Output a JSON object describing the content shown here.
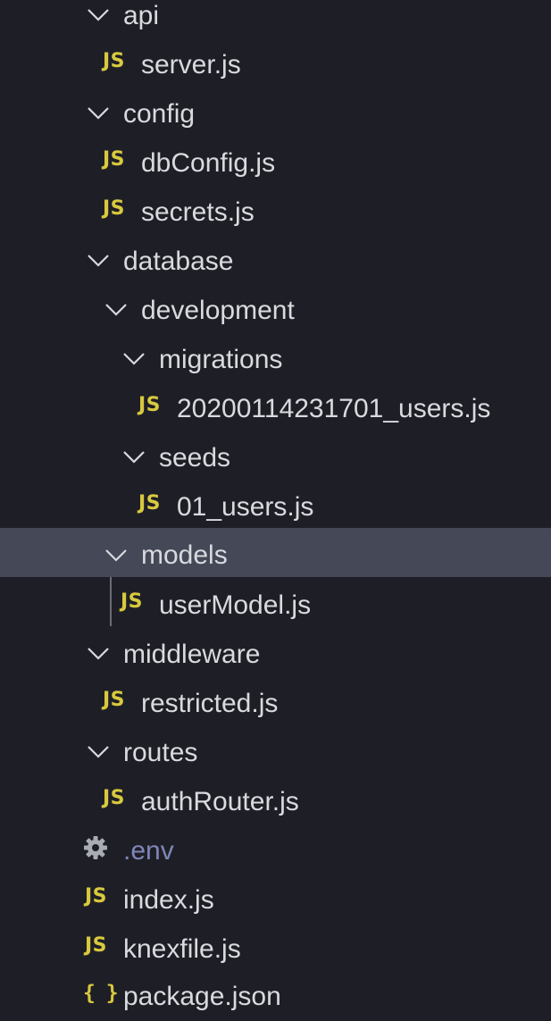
{
  "explorer": {
    "items": [
      {
        "label": "api",
        "type": "folder",
        "icon": "chevron-down-icon"
      },
      {
        "label": "server.js",
        "type": "file",
        "icon": "javascript-file-icon",
        "icon_text": "JS"
      },
      {
        "label": "config",
        "type": "folder",
        "icon": "chevron-down-icon"
      },
      {
        "label": "dbConfig.js",
        "type": "file",
        "icon": "javascript-file-icon",
        "icon_text": "JS"
      },
      {
        "label": "secrets.js",
        "type": "file",
        "icon": "javascript-file-icon",
        "icon_text": "JS"
      },
      {
        "label": "database",
        "type": "folder",
        "icon": "chevron-down-icon"
      },
      {
        "label": "development",
        "type": "folder",
        "icon": "chevron-down-icon"
      },
      {
        "label": "migrations",
        "type": "folder",
        "icon": "chevron-down-icon"
      },
      {
        "label": "20200114231701_users.js",
        "type": "file",
        "icon": "javascript-file-icon",
        "icon_text": "JS"
      },
      {
        "label": "seeds",
        "type": "folder",
        "icon": "chevron-down-icon"
      },
      {
        "label": "01_users.js",
        "type": "file",
        "icon": "javascript-file-icon",
        "icon_text": "JS"
      },
      {
        "label": "models",
        "type": "folder",
        "icon": "chevron-down-icon",
        "selected": true
      },
      {
        "label": "userModel.js",
        "type": "file",
        "icon": "javascript-file-icon",
        "icon_text": "JS"
      },
      {
        "label": "middleware",
        "type": "folder",
        "icon": "chevron-down-icon"
      },
      {
        "label": "restricted.js",
        "type": "file",
        "icon": "javascript-file-icon",
        "icon_text": "JS"
      },
      {
        "label": "routes",
        "type": "folder",
        "icon": "chevron-down-icon"
      },
      {
        "label": "authRouter.js",
        "type": "file",
        "icon": "javascript-file-icon",
        "icon_text": "JS"
      },
      {
        "label": ".env",
        "type": "file",
        "icon": "gear-icon",
        "dimmed": true
      },
      {
        "label": "index.js",
        "type": "file",
        "icon": "javascript-file-icon",
        "icon_text": "JS"
      },
      {
        "label": "knexfile.js",
        "type": "file",
        "icon": "javascript-file-icon",
        "icon_text": "JS"
      },
      {
        "label": "package.json",
        "type": "file",
        "icon": "json-file-icon",
        "icon_text": "{ }"
      }
    ]
  },
  "colors": {
    "background": "#1e1f26",
    "selected_row": "#444857",
    "text": "#d8dade",
    "js_icon": "#d8c93f",
    "dimmed_text": "#7e86b8",
    "gear_icon": "#a9acb4",
    "indent_guide": "#6a6d76"
  }
}
